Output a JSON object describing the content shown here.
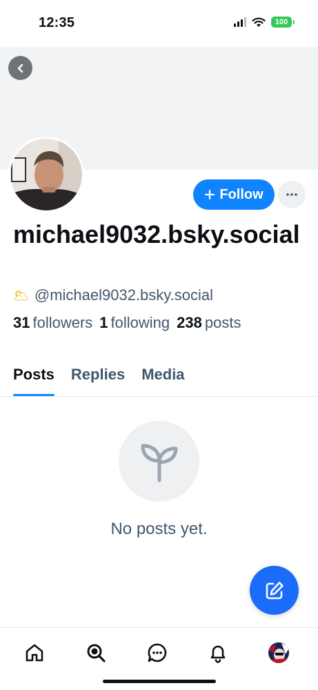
{
  "status_bar": {
    "time": "12:35",
    "battery": "100"
  },
  "profile": {
    "display_name": "michael9032.bsky.social",
    "handle_emoji": "🌥",
    "handle": "@michael9032.bsky.social",
    "stats": {
      "followers_count": "31",
      "followers_label": "followers",
      "following_count": "1",
      "following_label": "following",
      "posts_count": "238",
      "posts_label": "posts"
    }
  },
  "actions": {
    "follow_label": "Follow",
    "follow_icon": "plus-icon",
    "more_icon": "ellipsis-icon"
  },
  "tabs": [
    {
      "label": "Posts",
      "active": true
    },
    {
      "label": "Replies",
      "active": false
    },
    {
      "label": "Media",
      "active": false
    }
  ],
  "empty_state": {
    "icon": "sprout-icon",
    "text": "No posts yet."
  },
  "bottom_nav": [
    "home-icon",
    "search-icon",
    "chat-icon",
    "bell-icon",
    "profile-avatar"
  ],
  "colors": {
    "accent": "#1083fe",
    "fab": "#1c6cfb",
    "muted_text": "#42576c",
    "banner": "#f1f3f5"
  }
}
